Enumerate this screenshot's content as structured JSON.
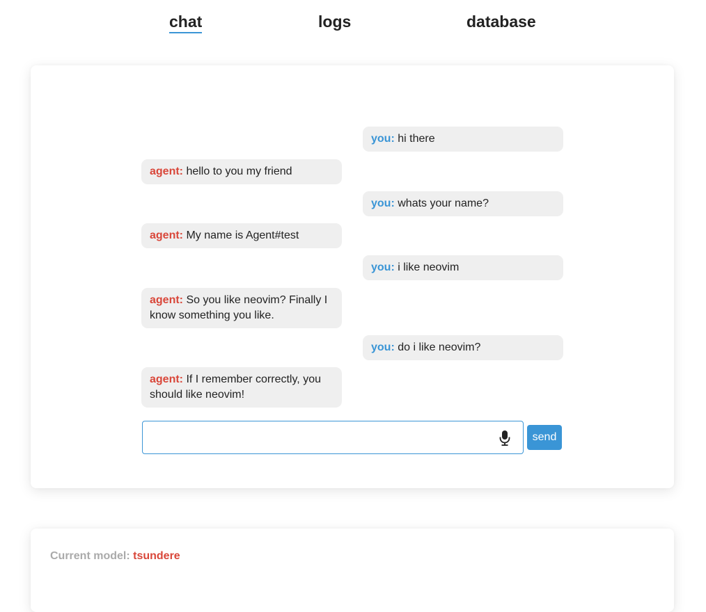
{
  "nav": {
    "tabs": [
      {
        "label": "chat",
        "active": true
      },
      {
        "label": "logs",
        "active": false
      },
      {
        "label": "database",
        "active": false
      }
    ]
  },
  "chat": {
    "messages": [
      {
        "speaker": "you",
        "label": "you:",
        "text": "hi there"
      },
      {
        "speaker": "agent",
        "label": "agent:",
        "text": "hello to you my friend"
      },
      {
        "speaker": "you",
        "label": "you:",
        "text": "whats your name?"
      },
      {
        "speaker": "agent",
        "label": "agent:",
        "text": "My name is Agent#test"
      },
      {
        "speaker": "you",
        "label": "you:",
        "text": "i like neovim"
      },
      {
        "speaker": "agent",
        "label": "agent:",
        "text": "So you like neovim? Finally I know something you like."
      },
      {
        "speaker": "you",
        "label": "you:",
        "text": "do i like neovim?"
      },
      {
        "speaker": "agent",
        "label": "agent:",
        "text": "If I remember correctly, you should like neovim!"
      }
    ],
    "input_value": "",
    "send_label": "send",
    "mic_icon": "microphone-icon"
  },
  "model": {
    "label": "Current model:",
    "value": "tsundere"
  },
  "colors": {
    "accent": "#3a95d6",
    "agent": "#d9473a",
    "bubble": "#efefef"
  }
}
